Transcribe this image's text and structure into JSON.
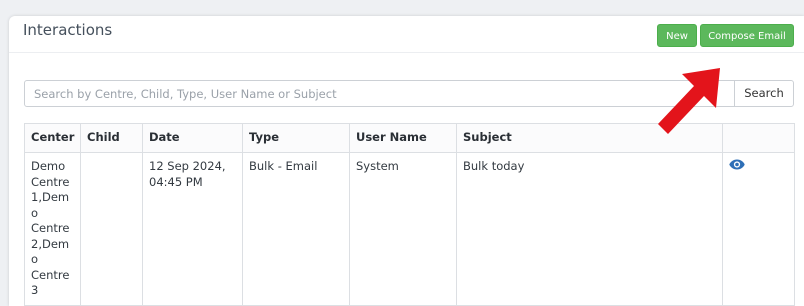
{
  "header": {
    "title": "Interactions",
    "new_label": "New",
    "compose_label": "Compose Email"
  },
  "search": {
    "placeholder": "Search by Centre, Child, Type, User Name or Subject",
    "button_label": "Search"
  },
  "colors": {
    "green_button": "#5cb85c",
    "arrow": "#e3141b",
    "eye_icon": "#2e6fb7"
  },
  "table": {
    "columns": [
      "Center",
      "Child",
      "Date",
      "Type",
      "User Name",
      "Subject",
      ""
    ],
    "rows": [
      {
        "center_lines": [
          "Demo",
          "Centre",
          "1,Demo",
          "Centre",
          "2,Demo",
          "Centre",
          "3"
        ],
        "child": "",
        "date_lines": [
          "12 Sep 2024,",
          "04:45 PM"
        ],
        "type": "Bulk - Email",
        "user_name": "System",
        "subject": "Bulk today",
        "action_icon": "eye-icon"
      }
    ]
  }
}
